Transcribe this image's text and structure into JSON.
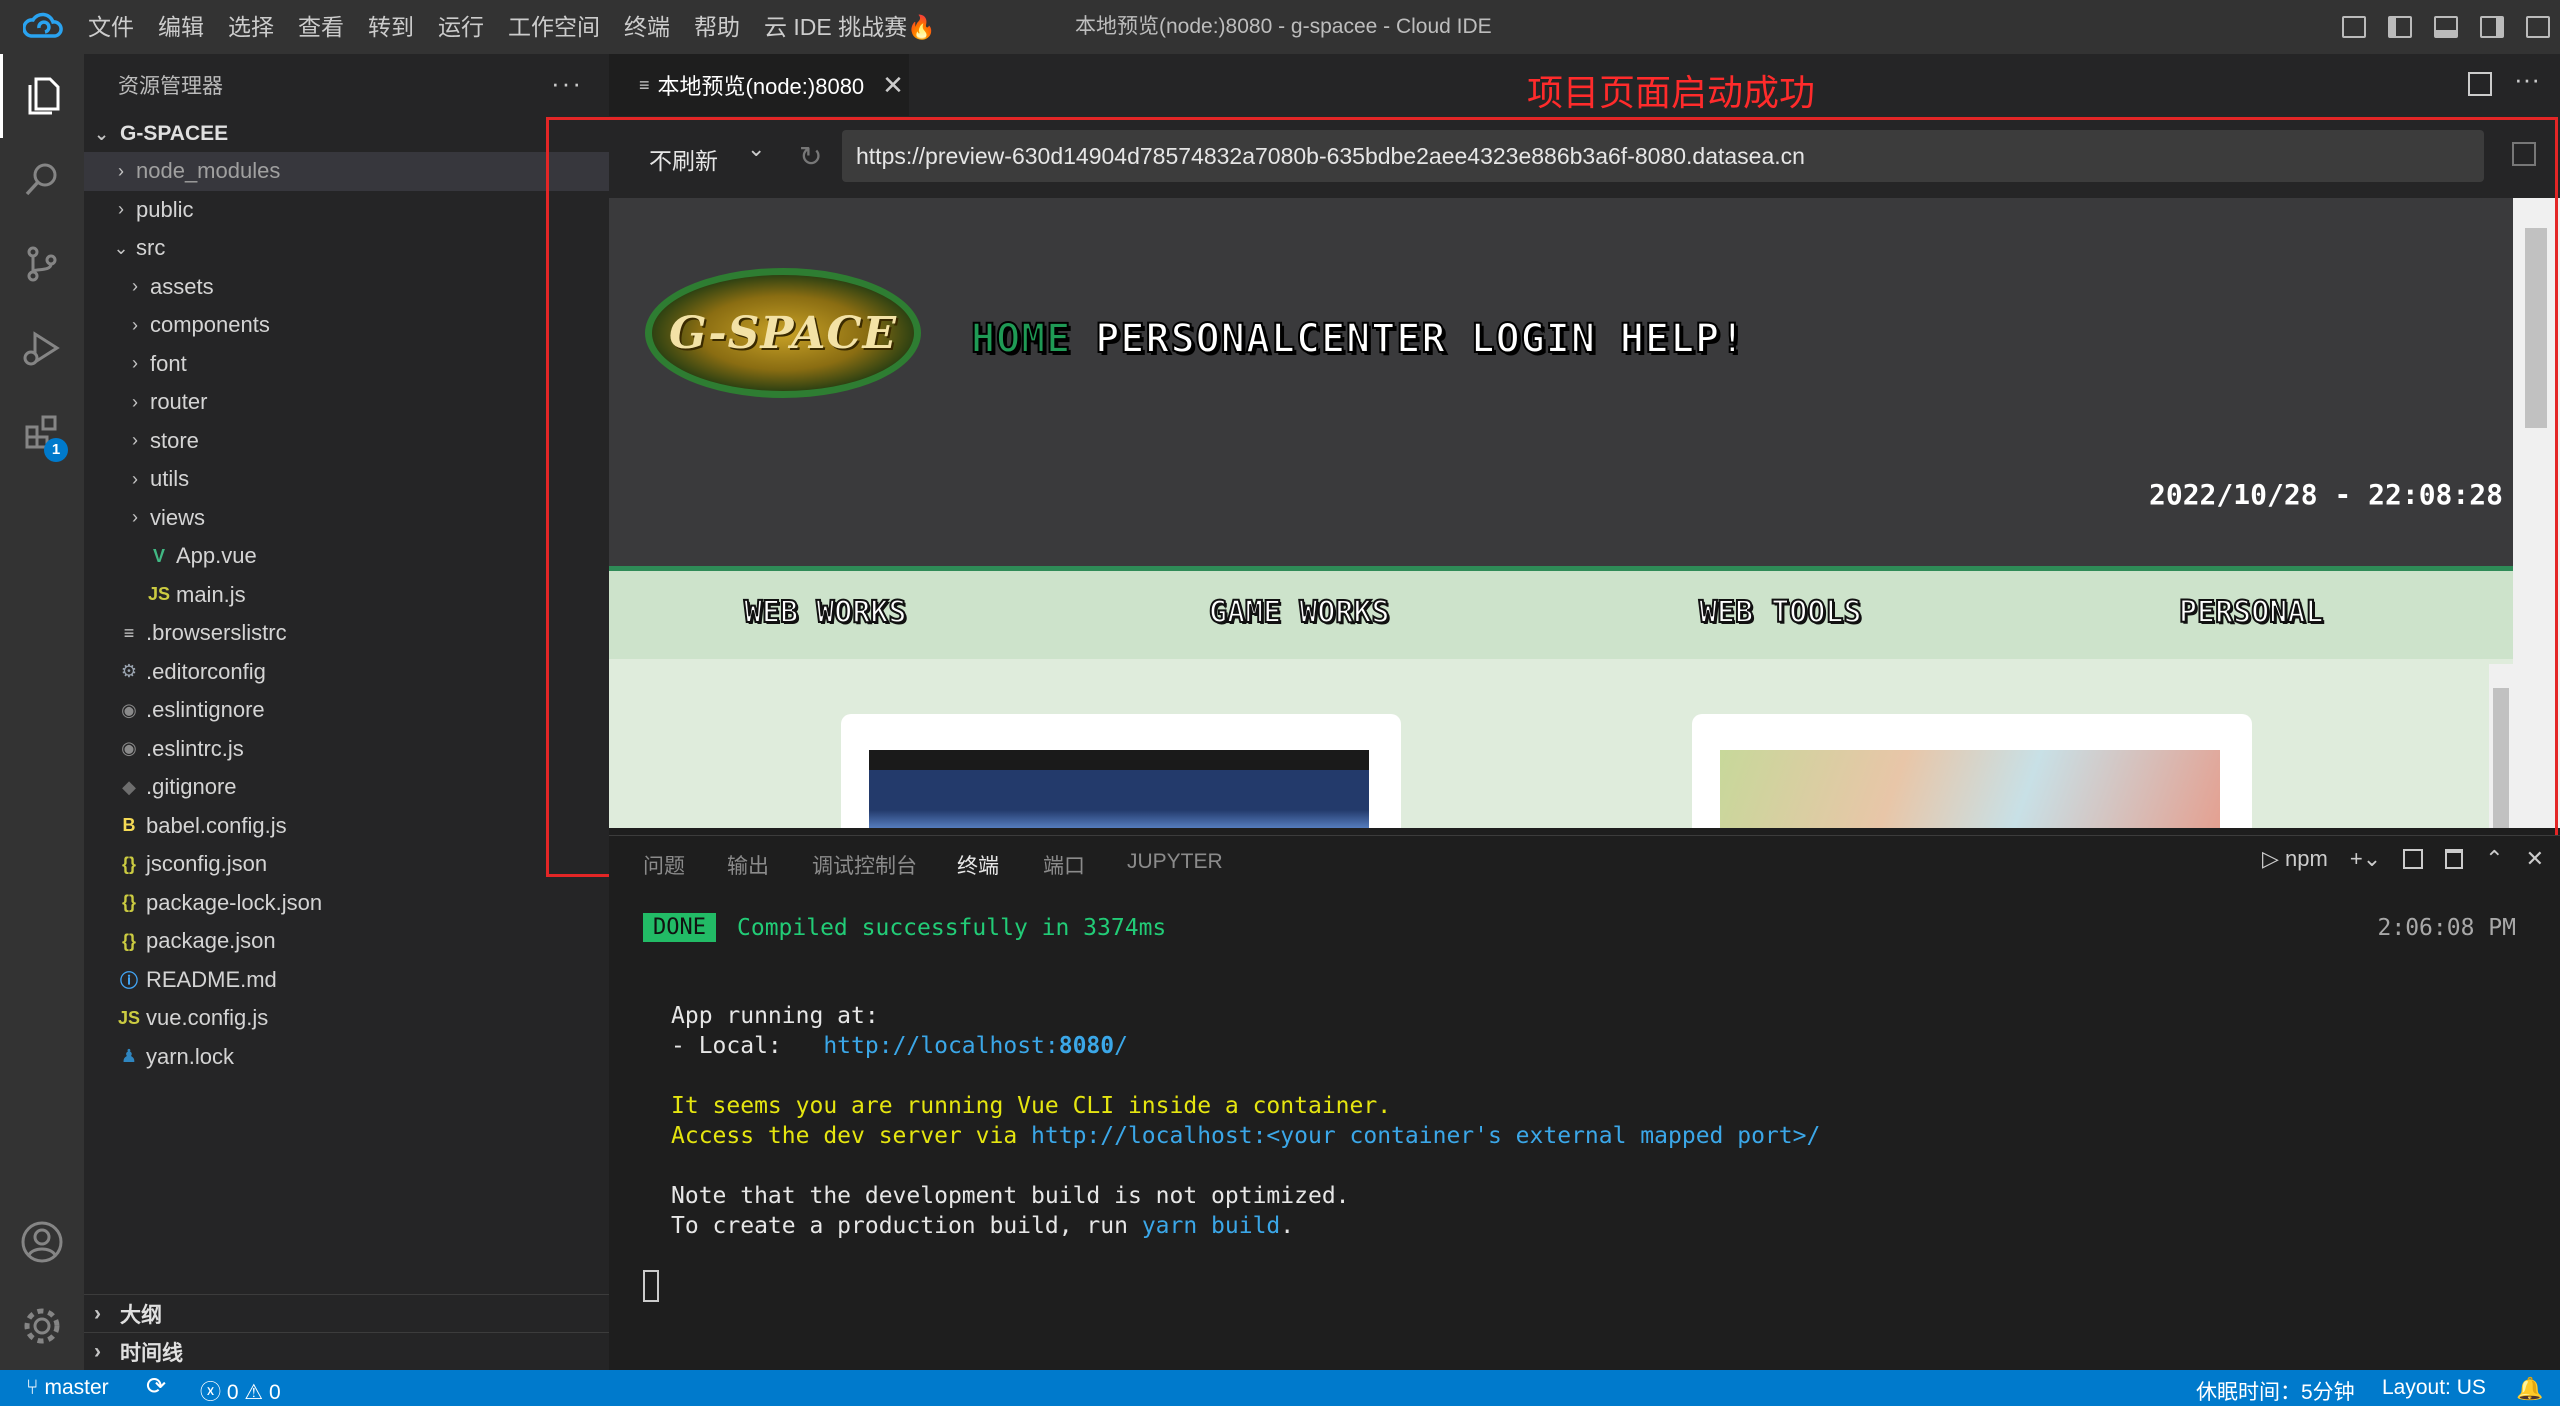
{
  "menu": [
    "文件",
    "编辑",
    "选择",
    "查看",
    "转到",
    "运行",
    "工作空间",
    "终端",
    "帮助",
    "云 IDE 挑战赛🔥"
  ],
  "window_title": "本地预览(node:)8080 - g-spacee - Cloud IDE",
  "sidebar": {
    "title": "资源管理器",
    "more": "···",
    "root": "G-SPACEE",
    "items": [
      {
        "label": "node_modules",
        "chevron": "›",
        "icon": ""
      },
      {
        "label": "public",
        "chevron": "›",
        "icon": ""
      },
      {
        "label": "src",
        "chevron": "⌄",
        "icon": ""
      },
      {
        "label": "assets",
        "chevron": "›",
        "icon": ""
      },
      {
        "label": "components",
        "chevron": "›",
        "icon": ""
      },
      {
        "label": "font",
        "chevron": "›",
        "icon": ""
      },
      {
        "label": "router",
        "chevron": "›",
        "icon": ""
      },
      {
        "label": "store",
        "chevron": "›",
        "icon": ""
      },
      {
        "label": "utils",
        "chevron": "›",
        "icon": ""
      },
      {
        "label": "views",
        "chevron": "›",
        "icon": ""
      },
      {
        "label": "App.vue",
        "chevron": "",
        "icon": "V"
      },
      {
        "label": "main.js",
        "chevron": "",
        "icon": "JS"
      },
      {
        "label": ".browserslistrc",
        "chevron": "",
        "icon": "≡"
      },
      {
        "label": ".editorconfig",
        "chevron": "",
        "icon": "⚙"
      },
      {
        "label": ".eslintignore",
        "chevron": "",
        "icon": "◉"
      },
      {
        "label": ".eslintrc.js",
        "chevron": "",
        "icon": "◉"
      },
      {
        "label": ".gitignore",
        "chevron": "",
        "icon": "◆"
      },
      {
        "label": "babel.config.js",
        "chevron": "",
        "icon": "B"
      },
      {
        "label": "jsconfig.json",
        "chevron": "",
        "icon": "{}"
      },
      {
        "label": "package-lock.json",
        "chevron": "",
        "icon": "{}"
      },
      {
        "label": "package.json",
        "chevron": "",
        "icon": "{}"
      },
      {
        "label": "README.md",
        "chevron": "",
        "icon": "ⓘ"
      },
      {
        "label": "vue.config.js",
        "chevron": "",
        "icon": "JS"
      },
      {
        "label": "yarn.lock",
        "chevron": "",
        "icon": "♟"
      }
    ],
    "outline": "大纲",
    "timeline": "时间线",
    "section_chevron": "›"
  },
  "activity": {
    "extensions_badge": "1"
  },
  "editor": {
    "tab_label": "本地预览(node:)8080",
    "tab_close": "✕",
    "tab_more": "···",
    "annotation": "项目页面启动成功",
    "refresh_mode": "不刷新",
    "refresh_chevron": "⌄",
    "reload_icon": "↻",
    "url": "https://preview-630d14904d78574832a7080b-635bdbe2aee4323e886b3a6f-8080.datasea.cn"
  },
  "site": {
    "logo": "G-SPACE",
    "nav": [
      "HOME",
      "PERSONALCENTER",
      "LOGIN",
      "HELP!"
    ],
    "datetime": "2022/10/28 - 22:08:28",
    "categories": [
      "WEB WORKS",
      "GAME WORKS",
      "WEB TOOLS",
      "PERSONAL"
    ]
  },
  "panel": {
    "tabs": [
      "问题",
      "输出",
      "调试控制台",
      "终端",
      "端口",
      "JUPYTER"
    ],
    "active_tab": "终端",
    "shell": "npm",
    "shell_icon": "▷",
    "add_icon": "+",
    "chevron": "⌄",
    "up_icon": "⌃",
    "close_icon": "✕"
  },
  "terminal": {
    "done_badge": "DONE",
    "compiled": "Compiled successfully in 3374ms",
    "time": "2:06:08 PM",
    "app_running": "App running at:",
    "local_prefix": "- Local:   ",
    "local_url": "http://localhost:",
    "local_port": "8080",
    "local_slash": "/",
    "container_warning": "It seems you are running Vue CLI inside a container.",
    "access_prefix": "Access the dev server via ",
    "access_url": "http://localhost:<your container's external mapped port>/",
    "note1": "Note that the development build is not optimized.",
    "note2_prefix": "To create a production build, run ",
    "note2_cmd": "yarn build",
    "note2_suffix": "."
  },
  "status": {
    "branch": "master",
    "sync_icon": "⟳",
    "errors": "0",
    "warnings": "0",
    "idle": "休眠时间：5分钟",
    "layout": "Layout: US"
  },
  "colors": {
    "accent": "#007acc",
    "annotation": "#e32626",
    "terminal_green": "#22cc77",
    "terminal_yellow": "#e5e510",
    "terminal_link": "#3ba7e8"
  }
}
